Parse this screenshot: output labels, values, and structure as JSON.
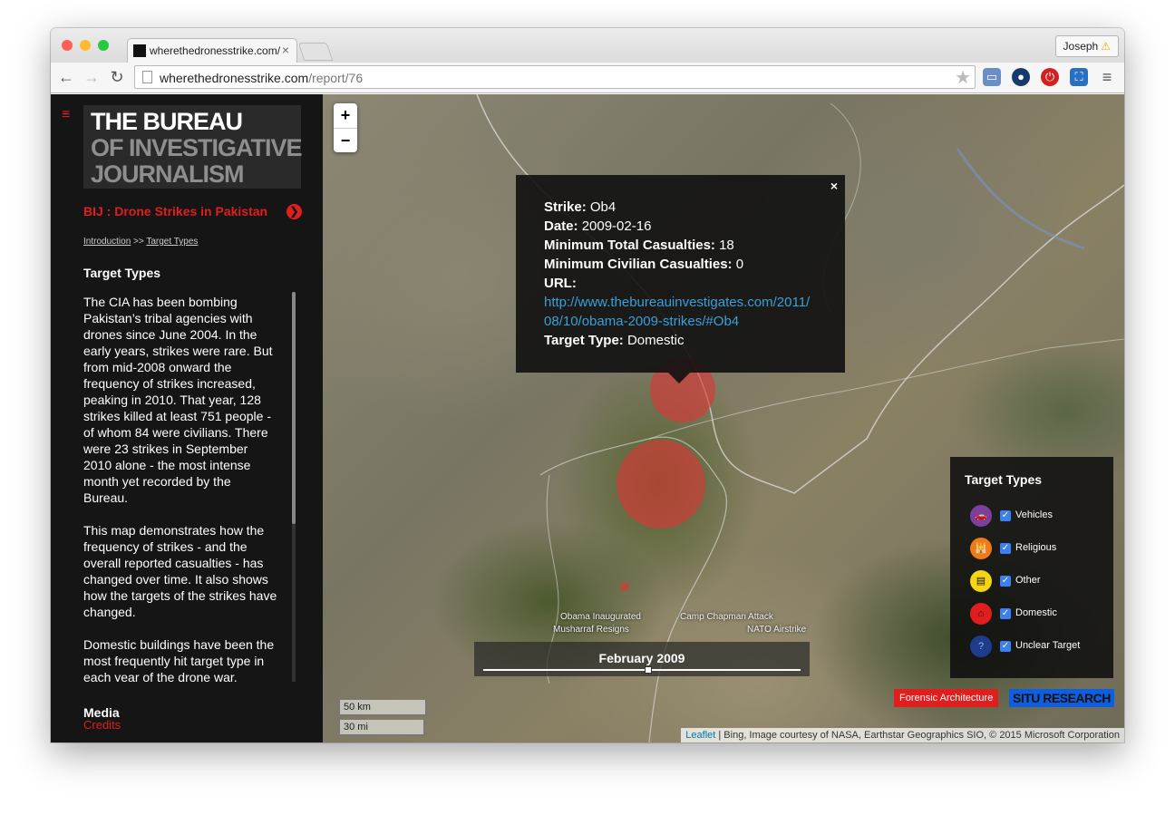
{
  "browser": {
    "tab_title": "wherethedronesstrike.com/",
    "tab_close": "×",
    "user": "Joseph",
    "user_warning": "⚠",
    "url_domain": "wherethedronesstrike.com",
    "url_path": "/report/76",
    "nav": {
      "back": "←",
      "forward": "→",
      "reload": "↻"
    },
    "star": "★",
    "menu": "≡"
  },
  "sidebar": {
    "menu_icon": "≡",
    "logo_line1": "THE BUREAU",
    "logo_line2": "OF INVESTIGATIVE",
    "logo_line3": "JOURNALISM",
    "report_title": "BIJ : Drone Strikes in Pakistan",
    "next_icon": "❯",
    "breadcrumb": {
      "intro": "Introduction",
      "separator": " >> ",
      "current": "Target Types"
    },
    "section_title": "Target Types",
    "paragraphs": [
      "The CIA has been bombing Pakistan’s tribal agencies with drones since June 2004. In the early years, strikes were rare. But from mid-2008 onward the frequency of strikes increased, peaking in 2010. That year, 128 strikes killed at least 751 people - of whom 84 were civilians. There were 23 strikes in September 2010 alone - the most intense month yet recorded by the Bureau.",
      "This map demonstrates how the frequency of strikes - and the overall reported casualties - has changed over time. It also shows how the targets of the strikes have changed.",
      "Domestic buildings have been the most frequently hit target type in each year of the drone war."
    ],
    "media_label": "Media",
    "credits_label": "Credits"
  },
  "map": {
    "zoom_in": "+",
    "zoom_out": "−",
    "popup": {
      "close": "×",
      "strike_label": "Strike:",
      "strike": "Ob4",
      "date_label": "Date:",
      "date": "2009-02-16",
      "min_total_label": "Minimum Total Casualties:",
      "min_total": "18",
      "min_civ_label": "Minimum Civilian Casualties:",
      "min_civ": "0",
      "url_label": "URL:",
      "url": "http://www.thebureauinvestigates.com/2011/08/10/obama-2009-strikes/#Ob4",
      "target_label": "Target Type:",
      "target": "Domestic"
    },
    "timeline_events": {
      "obama": "Obama Inaugurated",
      "musharraf": "Musharraf Resigns",
      "chapman": "Camp Chapman Attack",
      "nato": "NATO Airstrike"
    },
    "timeline_date": "February 2009",
    "scale_km": "50 km",
    "scale_mi": "30 mi",
    "legend": {
      "title": "Target Types",
      "items": [
        {
          "label": "Vehicles",
          "color": "#7b3f9e",
          "glyph": "🚗"
        },
        {
          "label": "Religious",
          "color": "#f07a1a",
          "glyph": "🕌"
        },
        {
          "label": "Other",
          "color": "#f5d516",
          "glyph": "▤"
        },
        {
          "label": "Domestic",
          "color": "#e01e1e",
          "glyph": "⌂"
        },
        {
          "label": "Unclear Target",
          "color": "#1f3c8c",
          "glyph": "?"
        }
      ],
      "check": "✓"
    },
    "badge_fa": "Forensic Architecture",
    "badge_situ": "SITU RESEARCH",
    "attribution_leaflet": "Leaflet",
    "attribution_rest": " | Bing, Image courtesy of NASA, Earthstar Geographics SIO, © 2015 Microsoft Corporation"
  }
}
